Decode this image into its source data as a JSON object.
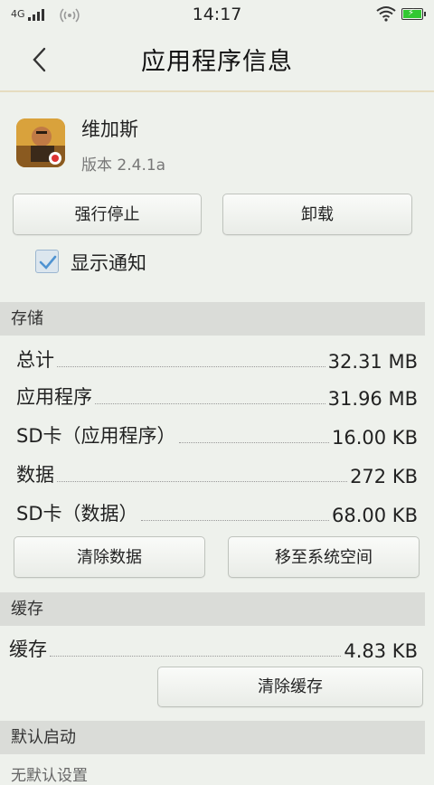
{
  "status_bar": {
    "network": "4G",
    "time": "14:17"
  },
  "header": {
    "title": "应用程序信息"
  },
  "app": {
    "name": "维加斯",
    "version": "版本 2.4.1a"
  },
  "actions": {
    "force_stop": "强行停止",
    "uninstall": "卸载"
  },
  "notifications": {
    "label": "显示通知",
    "checked": true
  },
  "storage": {
    "header": "存储",
    "rows": [
      {
        "label": "总计",
        "value": "32.31 MB"
      },
      {
        "label": "应用程序",
        "value": "31.96 MB"
      },
      {
        "label": "SD卡（应用程序）",
        "value": "16.00 KB"
      },
      {
        "label": "数据",
        "value": "272 KB"
      },
      {
        "label": "SD卡（数据）",
        "value": "68.00 KB"
      }
    ],
    "clear_data": "清除数据",
    "move_to_system": "移至系统空间"
  },
  "cache": {
    "header": "缓存",
    "label": "缓存",
    "value": "4.83 KB",
    "clear_cache": "清除缓存"
  },
  "default_launch": {
    "header": "默认启动",
    "status": "无默认设置"
  },
  "colors": {
    "background": "#eef1ec",
    "section": "#dadcd8",
    "accent": "#4f93d1",
    "battery": "#32c832"
  }
}
